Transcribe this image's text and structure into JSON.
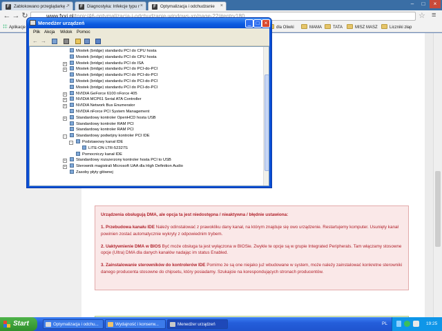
{
  "browser": {
    "tabs": [
      {
        "title": "Zablokowano przeglądarkę - ",
        "favicon": "F",
        "active": false
      },
      {
        "title": "Diagnostyka: Infekcje typu r",
        "favicon": "F",
        "active": false
      },
      {
        "title": "Optymalizacja i odchudzanie",
        "favicon": "F",
        "active": true
      }
    ],
    "url_host": "www.fxxi.pl",
    "url_path": "/topic/46-optymalizacja-i-odchudzanie-windows-xp/page-22/#entry180",
    "bookmarks": [
      "Aplikacje",
      "dla Oliwki",
      "MAMA",
      "TATA",
      "MISZ MASZ",
      "Liczniki złap"
    ]
  },
  "device_manager": {
    "title": "Menedżer urządzeń",
    "menu": [
      "Plik",
      "Akcja",
      "Widok",
      "Pomoc"
    ],
    "tree": [
      {
        "label": "Mostek (bridge) standardu PCI do CPU hosta",
        "indent": 0,
        "expander": ""
      },
      {
        "label": "Mostek (bridge) standardu PCI do CPU hosta",
        "indent": 0,
        "expander": ""
      },
      {
        "label": "Mostek (bridge) standardu PCI do ISA",
        "indent": 0,
        "expander": "+"
      },
      {
        "label": "Mostek (bridge) standardu PCI do PCI-do-PCI",
        "indent": 0,
        "expander": "+"
      },
      {
        "label": "Mostek (bridge) standardu PCI do PCI-do-PCI",
        "indent": 0,
        "expander": ""
      },
      {
        "label": "Mostek (bridge) standardu PCI do PCI-do-PCI",
        "indent": 0,
        "expander": ""
      },
      {
        "label": "Mostek (bridge) standardu PCI do PCI-do-PCI",
        "indent": 0,
        "expander": ""
      },
      {
        "label": "NVIDIA GeForce 6100 nForce 405",
        "indent": 0,
        "expander": "+"
      },
      {
        "label": "NVIDIA MCP61 Serial ATA Controller",
        "indent": 0,
        "expander": "+"
      },
      {
        "label": "NVIDIA Network Bus Enumerator",
        "indent": 0,
        "expander": "+"
      },
      {
        "label": "NVIDIA nForce PCI System Management",
        "indent": 0,
        "expander": ""
      },
      {
        "label": "Standardowy kontroler OpenHCD hosta USB",
        "indent": 0,
        "expander": "+"
      },
      {
        "label": "Standardowy kontroler RAM PCI",
        "indent": 0,
        "expander": ""
      },
      {
        "label": "Standardowy kontroler RAM PCI",
        "indent": 0,
        "expander": ""
      },
      {
        "label": "Standardowy podwójny kontroler PCI IDE",
        "indent": 0,
        "expander": "-"
      },
      {
        "label": "Podstawowy kanał IDE",
        "indent": 1,
        "expander": "-"
      },
      {
        "label": "LITE-ON LTR-52327S",
        "indent": 2,
        "expander": ""
      },
      {
        "label": "Pomocniczy kanał IDE",
        "indent": 1,
        "expander": ""
      },
      {
        "label": "Standardowy rozszerzony kontroler hosta PCI to USB",
        "indent": 0,
        "expander": "+"
      },
      {
        "label": "Sterownik magistrali Microsoft UAA dla High Definition Audio",
        "indent": 0,
        "expander": "+"
      },
      {
        "label": "Zasoby płyty głównej",
        "indent": 0,
        "expander": ""
      }
    ]
  },
  "page": {
    "info_heading": "Urządzenia obsługują DMA, ale opcja ta jest niedostępna / nieaktywna / błędnie ustawiona:",
    "points": [
      {
        "title": "1. Przebudowa kanału IDE",
        "text": " Należy odinstalować z prawokliku dany kanał, na którym znajduje się owo urządzenie. Restartujemy komputer. Usunięty kanał powinien zostać automatycznie wykryty z odpowiednim trybem."
      },
      {
        "title": "2. Uaktywnienie DMA w BIOS",
        "text": " Być może obsługa ta jest wyłączona w BIOSie. Zwykle te opcje są w grupie Integrated Peripherals. Tam włączamy stosowne opcje (Ultra) DMA dla danych kanałów nadając im status Enabled."
      },
      {
        "title": "3. Zainstalowanie sterowników do kontrolerów IDE",
        "text": " Pomimo że są one niejako już wbudowane w system, może należy zainstalować konkretne sterowniki danego producenta stosowne do chipsetu, który posiadamy. Szukajcie na korespondujących stronach producentów."
      }
    ]
  },
  "taskbar": {
    "start_label": "Start",
    "tasks": [
      "Optymalizacja i odchu...",
      "Wydajność i konserw...",
      "Menedżer urządzeń"
    ],
    "language": "PL",
    "clock": "19:25"
  }
}
